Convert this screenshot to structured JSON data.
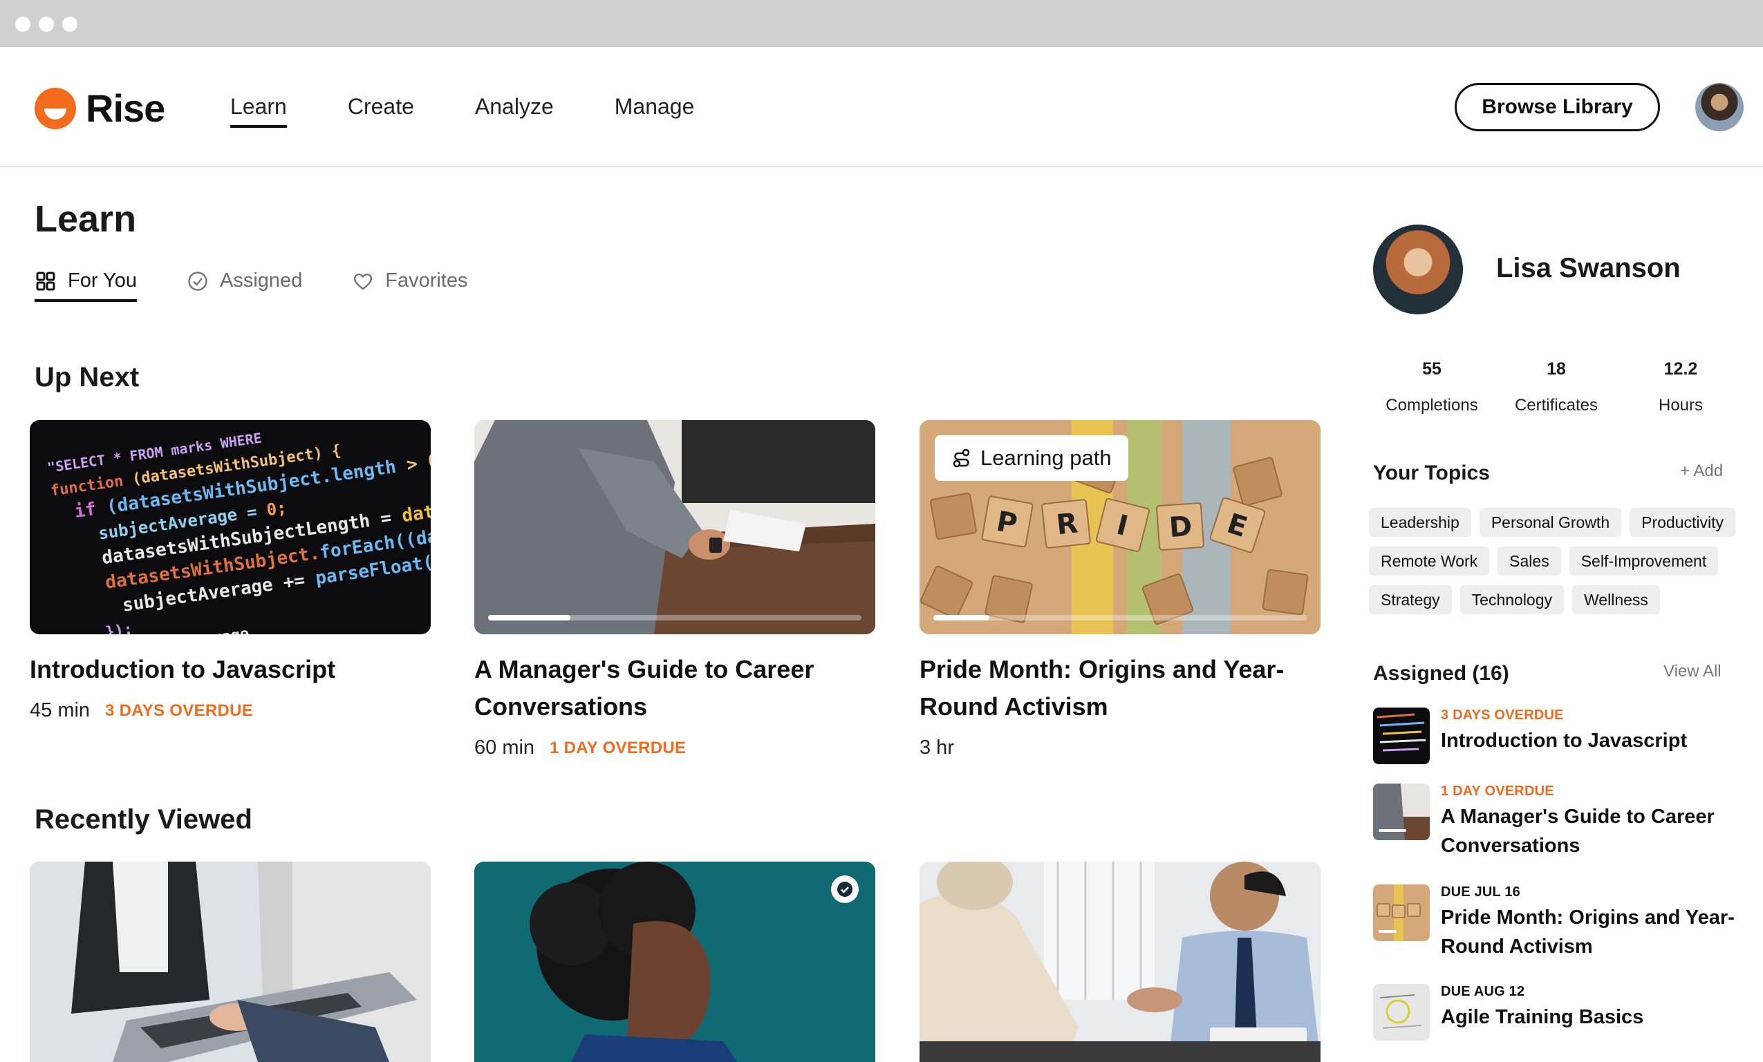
{
  "app": {
    "name": "Rise"
  },
  "nav": {
    "items": [
      "Learn",
      "Create",
      "Analyze",
      "Manage"
    ],
    "active": "Learn"
  },
  "header": {
    "browse_label": "Browse Library"
  },
  "page": {
    "title": "Learn"
  },
  "tabs": [
    {
      "label": "For You",
      "icon": "grid-icon",
      "active": true
    },
    {
      "label": "Assigned",
      "icon": "check-circle-icon",
      "active": false
    },
    {
      "label": "Favorites",
      "icon": "heart-icon",
      "active": false
    }
  ],
  "up_next": {
    "title": "Up Next",
    "cards": [
      {
        "title": "Introduction to Javascript",
        "duration": "45 min",
        "status": "3 DAYS OVERDUE",
        "progress": 0
      },
      {
        "title": "A Manager's Guide to Career Conversations",
        "duration": "60 min",
        "status": "1 DAY OVERDUE",
        "progress": 0.22
      },
      {
        "title": "Pride Month: Origins and Year-Round Activism",
        "duration": "3 hr",
        "status": "",
        "badge": "Learning path",
        "progress": 0.15
      }
    ]
  },
  "recently_viewed": {
    "title": "Recently Viewed"
  },
  "profile": {
    "name": "Lisa Swanson",
    "stats": [
      {
        "value": "55",
        "label": "Completions"
      },
      {
        "value": "18",
        "label": "Certificates"
      },
      {
        "value": "12.2",
        "label": "Hours"
      }
    ]
  },
  "topics": {
    "title": "Your Topics",
    "add_label": "+ Add",
    "items": [
      "Leadership",
      "Personal Growth",
      "Productivity",
      "Remote Work",
      "Sales",
      "Self-Improvement",
      "Strategy",
      "Technology",
      "Wellness"
    ]
  },
  "assigned": {
    "title": "Assigned (16)",
    "view_all": "View All",
    "items": [
      {
        "status": "3 DAYS OVERDUE",
        "title": "Introduction to Javascript"
      },
      {
        "status": "1 DAY OVERDUE",
        "title": "A Manager's Guide to Career Conversations"
      },
      {
        "status": "DUE JUL 16",
        "title": "Pride Month: Origins and Year-Round Activism"
      },
      {
        "status": "DUE AUG 12",
        "title": "Agile Training Basics"
      }
    ]
  },
  "colors": {
    "accent": "#f26a1b",
    "text": "#111111",
    "chip_bg": "#eeeeee"
  }
}
